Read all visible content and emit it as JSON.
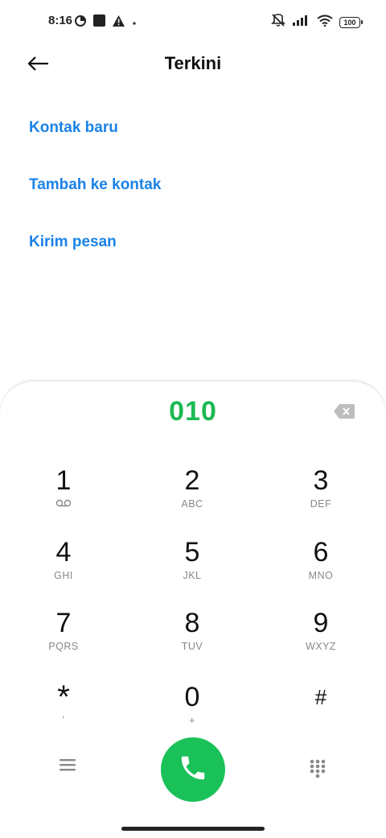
{
  "status_bar": {
    "time": "8:16",
    "battery": "100",
    "icons": [
      "data-saver-icon",
      "square-notification-icon",
      "warning-icon",
      "dot-icon",
      "silent-icon",
      "signal-icon",
      "wifi-icon",
      "battery-icon"
    ]
  },
  "header": {
    "title": "Terkini",
    "back_icon": "arrow-left-icon"
  },
  "actions": [
    {
      "label": "Kontak baru"
    },
    {
      "label": "Tambah ke kontak"
    },
    {
      "label": "Kirim pesan"
    }
  ],
  "dialer": {
    "number": "010",
    "keys": [
      {
        "digit": "1",
        "letters": ""
      },
      {
        "digit": "2",
        "letters": "ABC"
      },
      {
        "digit": "3",
        "letters": "DEF"
      },
      {
        "digit": "4",
        "letters": "GHI"
      },
      {
        "digit": "5",
        "letters": "JKL"
      },
      {
        "digit": "6",
        "letters": "MNO"
      },
      {
        "digit": "7",
        "letters": "PQRS"
      },
      {
        "digit": "8",
        "letters": "TUV"
      },
      {
        "digit": "9",
        "letters": "WXYZ"
      },
      {
        "digit": "*",
        "letters": ","
      },
      {
        "digit": "0",
        "letters": "+"
      },
      {
        "digit": "#",
        "letters": ""
      }
    ]
  },
  "colors": {
    "accent_blue": "#1a82e8",
    "accent_green": "#1db954",
    "call_green": "#1ac159"
  }
}
